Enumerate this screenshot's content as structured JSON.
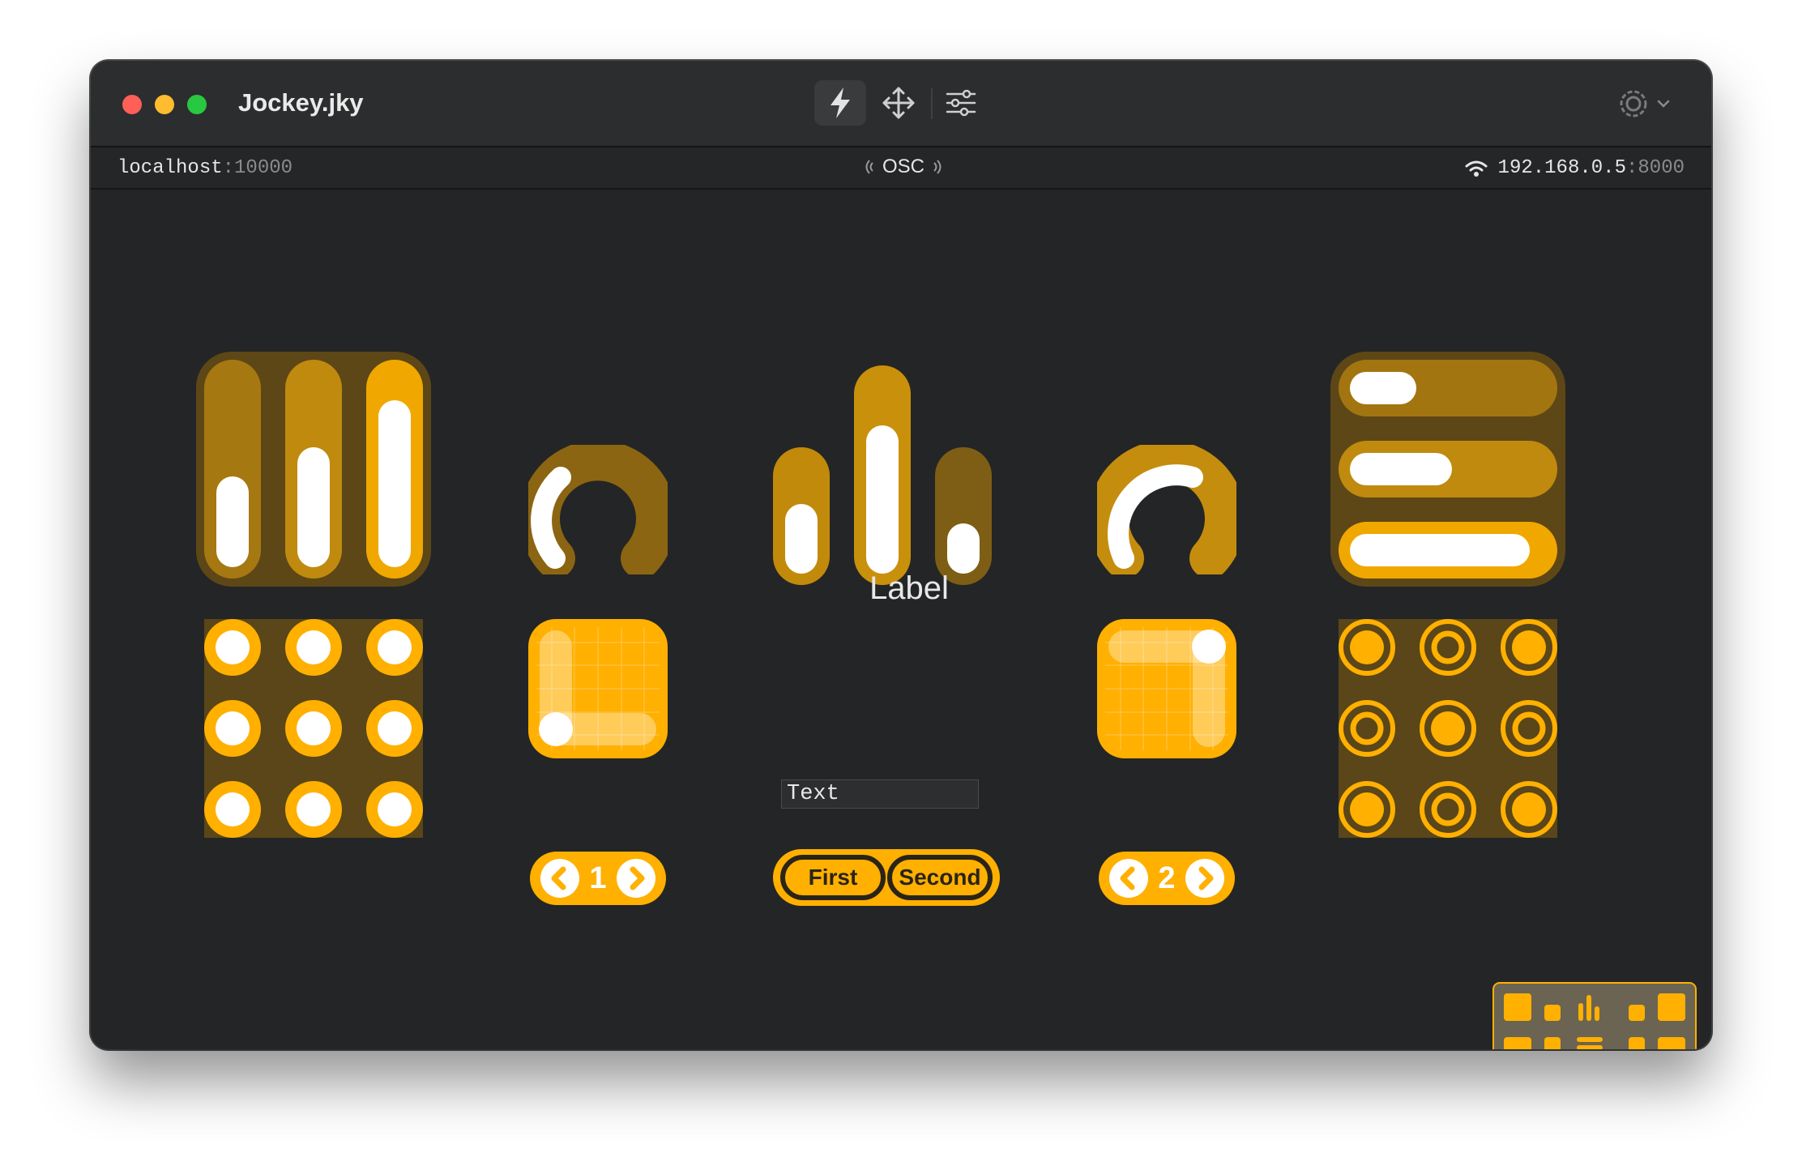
{
  "window": {
    "title": "Jockey.jky"
  },
  "toolbar": {
    "run_icon": "lightning-bolt-icon",
    "move_icon": "move-arrows-icon",
    "sliders_icon": "sliders-icon",
    "settings_icon": "gear-icon"
  },
  "statusbar": {
    "local_host": "localhost",
    "local_port": ":10000",
    "protocol": "OSC",
    "remote_ip": "192.168.0.5",
    "remote_port": ":8000"
  },
  "widgets": {
    "label": "Label",
    "text_value": "Text",
    "stepper_left_value": "1",
    "stepper_right_value": "2",
    "segment_first": "First",
    "segment_second": "Second"
  },
  "colors": {
    "accent": "#ffb000",
    "accent_dark": "#8a6612",
    "background": "#242526"
  }
}
